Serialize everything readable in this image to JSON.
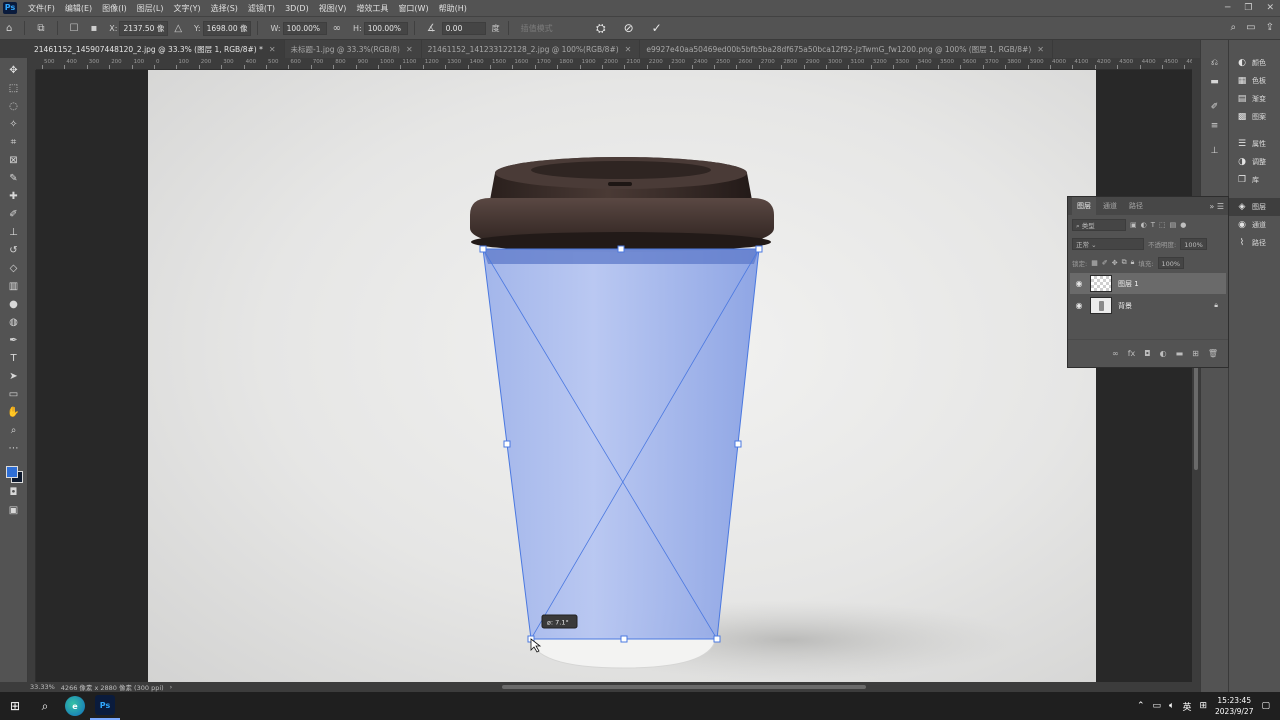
{
  "menu": {
    "logo": "Ps",
    "items": [
      "文件(F)",
      "编辑(E)",
      "图像(I)",
      "图层(L)",
      "文字(Y)",
      "选择(S)",
      "滤镜(T)",
      "3D(D)",
      "视图(V)",
      "增效工具",
      "窗口(W)",
      "帮助(H)"
    ]
  },
  "options": {
    "x_label": "X:",
    "x_value": "2137.50 像",
    "y_label": "Y:",
    "y_value": "1698.00 像",
    "w_label": "W:",
    "w_value": "100.00%",
    "h_label": "H:",
    "h_value": "100.00%",
    "angle_value": "0.00",
    "angle_unit": "度",
    "interp_label": "插值模式"
  },
  "tabs": [
    {
      "label": "21461152_145907448120_2.jpg @ 33.3% (图层 1, RGB/8#) *",
      "active": true
    },
    {
      "label": "未标题-1.jpg @ 33.3%(RGB/8)",
      "active": false
    },
    {
      "label": "21461152_141233122128_2.jpg @ 100%(RGB/8#)",
      "active": false
    },
    {
      "label": "e9927e40aa50469ed00b5bfb5ba28df675a50bca12f92-JzTwmG_fw1200.png @ 100% (图层 1, RGB/8#)",
      "active": false
    }
  ],
  "ruler_top_labels": [
    "500",
    "400",
    "300",
    "200",
    "100",
    "0",
    "100",
    "200",
    "300",
    "400",
    "500",
    "600",
    "700",
    "800",
    "900",
    "1000",
    "1100",
    "1200",
    "1300",
    "1400",
    "1500",
    "1600",
    "1700",
    "1800",
    "1900",
    "2000",
    "2100",
    "2200",
    "2300",
    "2400",
    "2500",
    "2600",
    "2700",
    "2800",
    "2900",
    "3000",
    "3100",
    "3200",
    "3300",
    "3400",
    "3500",
    "3600",
    "3700",
    "3800",
    "3900",
    "4000",
    "4100",
    "4200",
    "4300",
    "4400",
    "4500",
    "4600"
  ],
  "transform_tooltip": "⌀: 7.1°",
  "status": {
    "zoom": "33.33%",
    "doc_info": "4266 像素 x 2880 像素 (300 ppi)"
  },
  "dock_panels": [
    {
      "icon": "color-icon",
      "glyph": "◐",
      "label": "颜色"
    },
    {
      "icon": "swatches-icon",
      "glyph": "▦",
      "label": "色板"
    },
    {
      "icon": "gradient-icon",
      "glyph": "▤",
      "label": "渐变"
    },
    {
      "icon": "patterns-icon",
      "glyph": "▩",
      "label": "图案"
    },
    {
      "icon": "properties-icon",
      "glyph": "☰",
      "label": "属性"
    },
    {
      "icon": "adjustments-icon",
      "glyph": "◑",
      "label": "调整"
    },
    {
      "icon": "libraries-icon",
      "glyph": "❐",
      "label": "库"
    },
    {
      "icon": "layers-icon",
      "glyph": "◈",
      "label": "图层"
    },
    {
      "icon": "channels-icon",
      "glyph": "◉",
      "label": "通道"
    },
    {
      "icon": "paths-icon",
      "glyph": "⌇",
      "label": "路径"
    }
  ],
  "layers_panel": {
    "tabs": [
      "图层",
      "通道",
      "路径"
    ],
    "search_placeholder": "类型",
    "blend_mode": "正常",
    "opacity_label": "不透明度:",
    "opacity_value": "100%",
    "lock_label": "锁定:",
    "fill_label": "填充:",
    "fill_value": "100%",
    "layers": [
      {
        "name": "图层 1",
        "selected": true,
        "locked": false
      },
      {
        "name": "背景",
        "selected": false,
        "locked": true
      }
    ]
  },
  "taskbar": {
    "time": "15:23:45",
    "date": "2023/9/27",
    "lang": "英"
  },
  "colors": {
    "foreground": "#2f6fd6",
    "background": "#0e1a2e",
    "transform_overlay": "#8aa6ee",
    "selection_line": "#4a78e0"
  }
}
